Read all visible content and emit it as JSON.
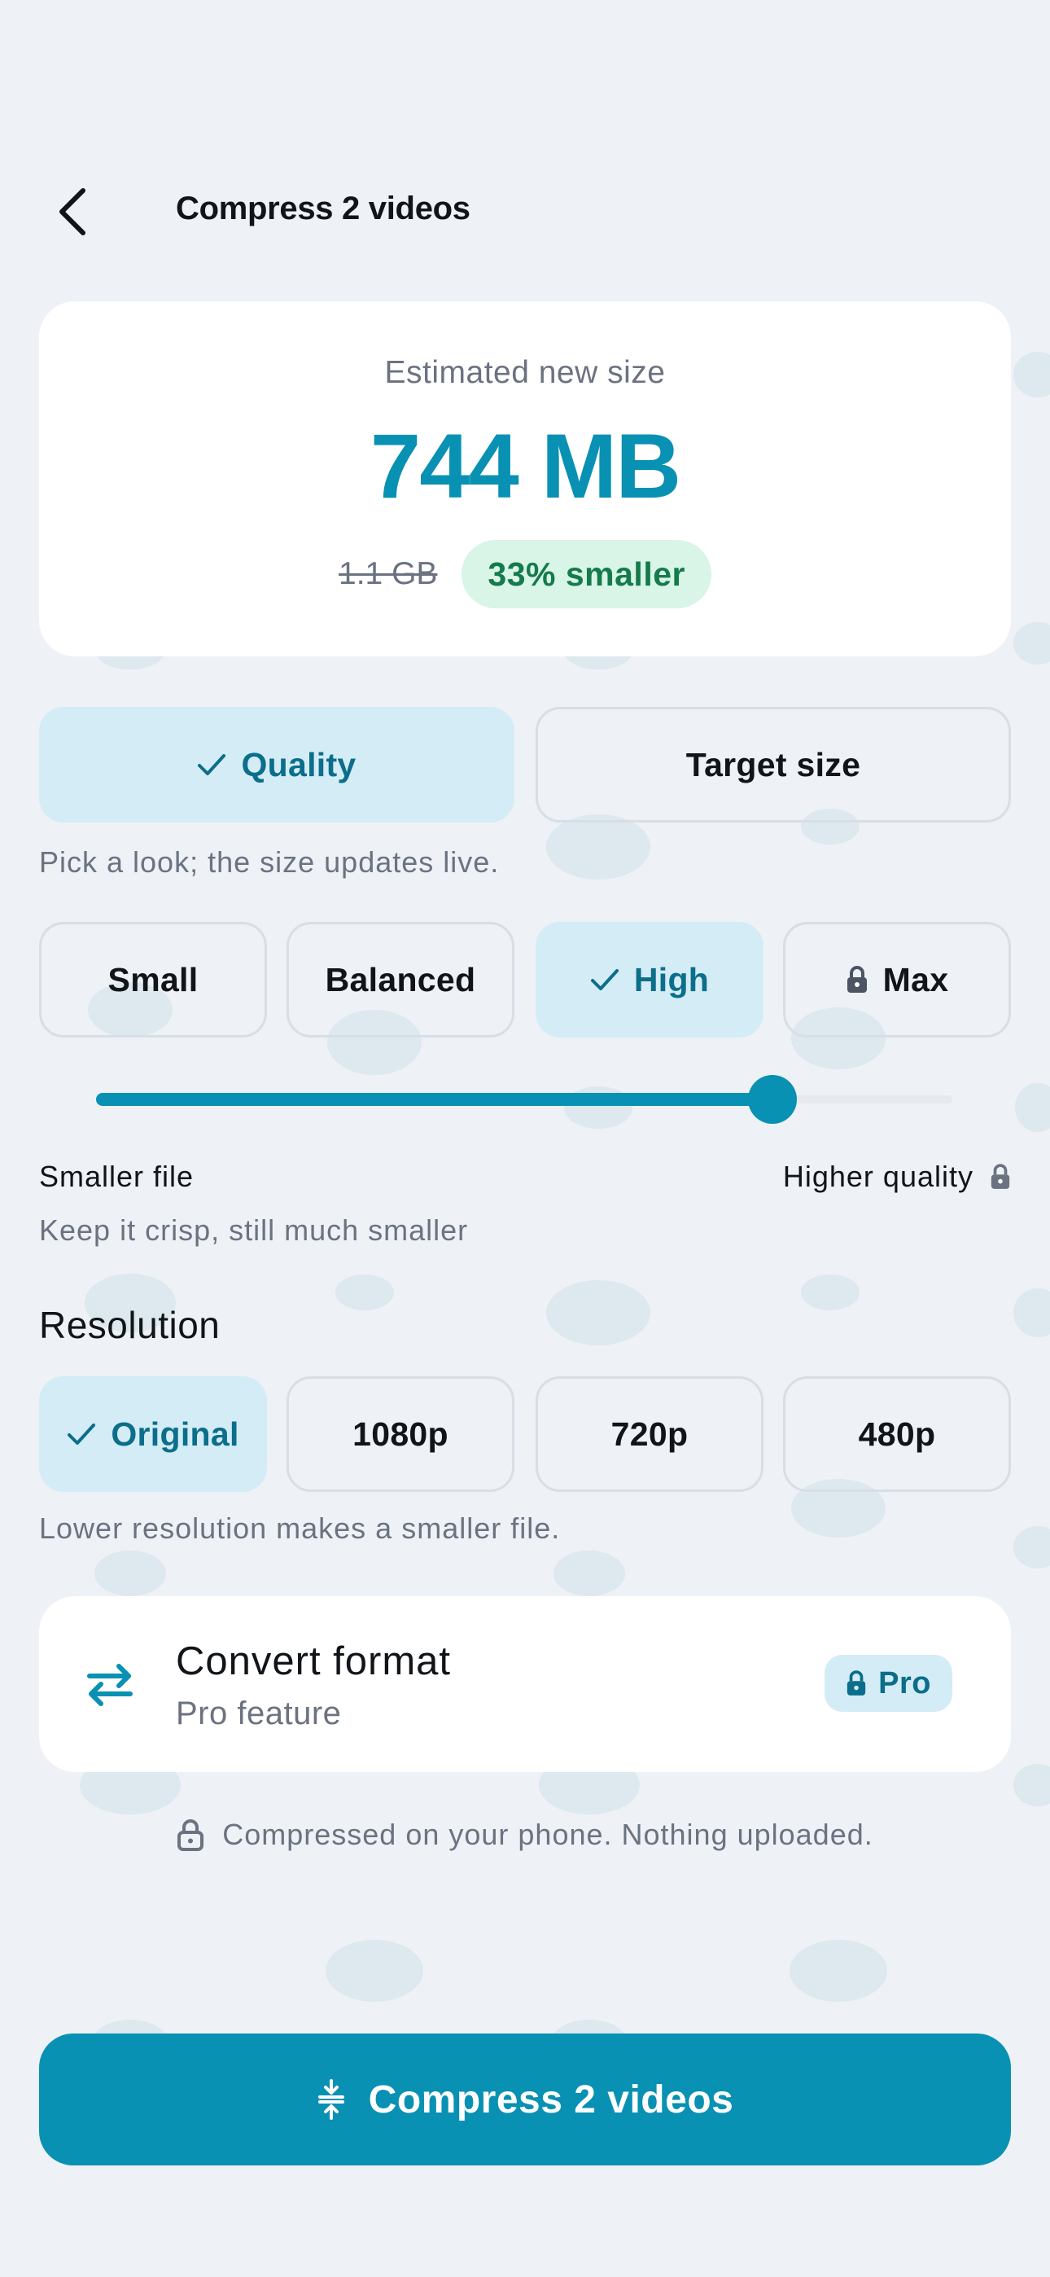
{
  "header": {
    "title": "Compress 2 videos"
  },
  "estimate": {
    "label": "Estimated new size",
    "new_size": "744 MB",
    "original_size": "1.1 GB",
    "savings": "33% smaller"
  },
  "mode_tabs": [
    {
      "label": "Quality",
      "active": true
    },
    {
      "label": "Target size",
      "active": false
    }
  ],
  "quality_hint": "Pick a look; the size updates live.",
  "presets": [
    {
      "label": "Small",
      "active": false,
      "locked": false
    },
    {
      "label": "Balanced",
      "active": false,
      "locked": false
    },
    {
      "label": "High",
      "active": true,
      "locked": false
    },
    {
      "label": "Max",
      "active": false,
      "locked": true
    }
  ],
  "slider": {
    "value_fraction": 0.79,
    "min_label": "Smaller file",
    "max_label": "Higher quality",
    "caption": "Keep it crisp, still much smaller"
  },
  "resolution": {
    "title": "Resolution",
    "options": [
      {
        "label": "Original",
        "active": true
      },
      {
        "label": "1080p",
        "active": false
      },
      {
        "label": "720p",
        "active": false
      },
      {
        "label": "480p",
        "active": false
      }
    ],
    "hint": "Lower resolution makes a smaller file."
  },
  "convert": {
    "title": "Convert format",
    "subtitle": "Pro feature",
    "badge": "Pro"
  },
  "privacy_note": "Compressed on your phone. Nothing uploaded.",
  "primary_button": {
    "label": "Compress 2 videos"
  },
  "colors": {
    "accent": "#0891b2",
    "accent_soft": "#d4ecf5",
    "success": "#157a4c",
    "success_soft": "#d8f5e7",
    "background": "#eef1f6"
  }
}
